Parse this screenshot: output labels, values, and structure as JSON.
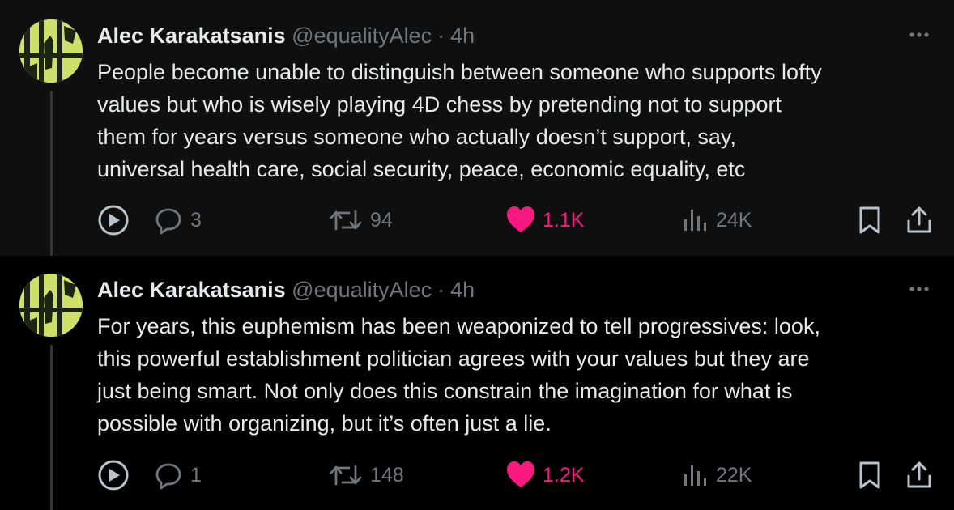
{
  "tweets": [
    {
      "author": {
        "name": "Alec Karakatsanis",
        "handle": "@equalityAlec"
      },
      "separator": "·",
      "time": "4h",
      "text": "People become unable to distinguish between someone who supports lofty\nvalues but who is wisely playing 4D chess by pretending not to support\nthem for years versus someone who actually doesn’t support, say,\nuniversal health care, social security, peace, economic equality, etc",
      "stats": {
        "replies": "3",
        "reposts": "94",
        "likes": "1.1K",
        "views": "24K"
      }
    },
    {
      "author": {
        "name": "Alec Karakatsanis",
        "handle": "@equalityAlec"
      },
      "separator": "·",
      "time": "4h",
      "text": "For years, this euphemism has been weaponized to tell progressives: look,\nthis powerful establishment politician agrees with your values but they are\njust being smart. Not only does this constrain the imagination for what is\npossible with organizing, but it’s often just a lie.",
      "stats": {
        "replies": "1",
        "reposts": "148",
        "likes": "1.2K",
        "views": "22K"
      }
    }
  ],
  "colors": {
    "background": "#000000",
    "first_tweet_background": "#0f0f0f",
    "text": "#e7e9ea",
    "muted": "#71767b",
    "like_active": "#f91880",
    "avatar_accent": "#cfe06a"
  },
  "icons": [
    "avatar-image",
    "more-icon",
    "play-icon",
    "reply-icon",
    "retweet-icon",
    "heart-icon",
    "views-icon",
    "bookmark-icon",
    "share-icon"
  ]
}
